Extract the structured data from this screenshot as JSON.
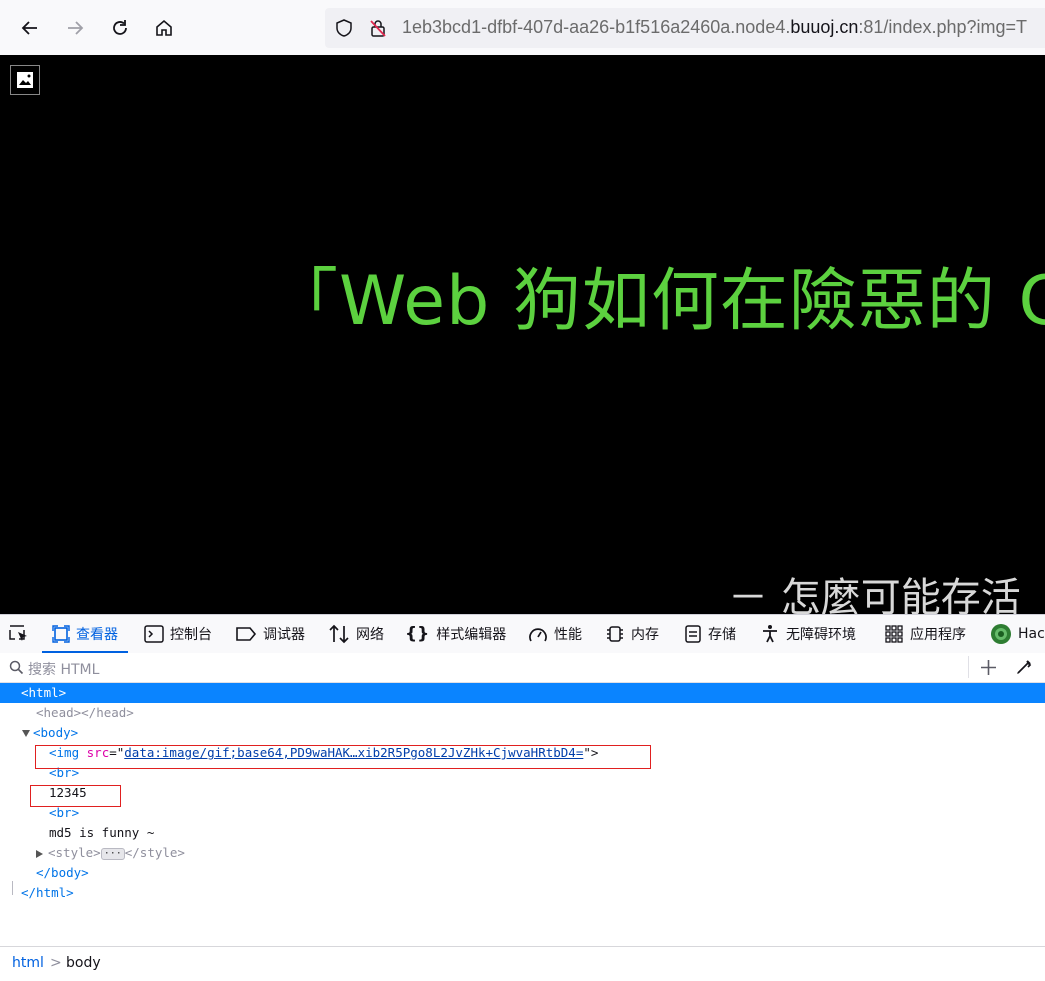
{
  "browser": {
    "url_prefix": "1eb3bcd1-dfbf-407d-aa26-b1f516a2460a.node4.",
    "url_domain": "buuoj.cn",
    "url_suffix": ":81/index.php?img=T"
  },
  "page": {
    "headline": "「Web 狗如何在險惡的 C",
    "subline": "－ 怎麼可能存活"
  },
  "devtools": {
    "tabs": [
      {
        "label": "查看器"
      },
      {
        "label": "控制台"
      },
      {
        "label": "调试器"
      },
      {
        "label": "网络"
      },
      {
        "label": "样式编辑器"
      },
      {
        "label": "性能"
      },
      {
        "label": "内存"
      },
      {
        "label": "存储"
      },
      {
        "label": "无障碍环境"
      },
      {
        "label": "应用程序"
      },
      {
        "label": "Hac"
      }
    ],
    "search_placeholder": "搜索 HTML",
    "tree": {
      "html_open": "<html>",
      "head": "<head></head>",
      "body_open": "<body>",
      "img_tag_open": "<img ",
      "img_attr": "src",
      "img_eq": "=\"",
      "img_src": "data:image/gif;base64,PD9waHAK…xib2R5Pgo8L2JvZHk+CjwvaHRtbD4=",
      "img_close": "\">",
      "br": "<br>",
      "text1": "12345",
      "text2": "md5 is funny ~",
      "style_open": "<style>",
      "style_ellipsis": "···",
      "style_close": "</style>",
      "body_close": "</body>",
      "html_close": "</html>"
    },
    "breadcrumbs": [
      "html",
      "body"
    ],
    "breadcrumb_separator": ">"
  },
  "colors": {
    "accent": "#0061e0",
    "selection": "#0a84ff",
    "headline": "#5cd13f",
    "annotation_box": "#e02020"
  }
}
